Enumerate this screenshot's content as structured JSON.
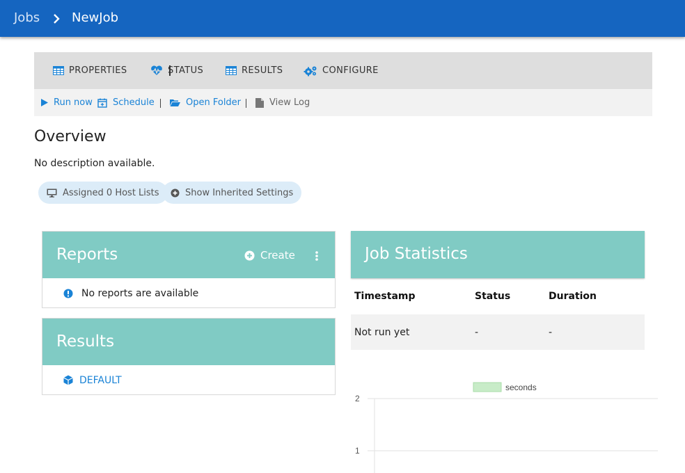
{
  "breadcrumb": {
    "root": "Jobs",
    "current": "NewJob"
  },
  "tabs": [
    {
      "label": "PROPERTIES",
      "icon": "table-icon"
    },
    {
      "label": "STATUS",
      "icon": "heartbeat-icon"
    },
    {
      "label": "RESULTS",
      "icon": "table-icon"
    },
    {
      "label": "CONFIGURE",
      "icon": "gears-icon"
    }
  ],
  "actions": {
    "run_now": "Run now",
    "schedule": "Schedule",
    "open_folder": "Open Folder",
    "view_log": "View Log"
  },
  "overview": {
    "title": "Overview",
    "description": "No description available.",
    "host_lists_chip": "Assigned 0 Host Lists",
    "inherited_chip": "Show Inherited Settings"
  },
  "reports": {
    "title": "Reports",
    "create_label": "Create",
    "empty_message": "No reports are available"
  },
  "results": {
    "title": "Results",
    "items": [
      "DEFAULT"
    ]
  },
  "job_statistics": {
    "title": "Job Statistics",
    "columns": [
      "Timestamp",
      "Status",
      "Duration"
    ],
    "rows": [
      [
        "Not run yet",
        "-",
        "-"
      ]
    ]
  },
  "colors": {
    "topbar": "#1565c0",
    "card_header": "#80cbc4",
    "link": "#1a83d6",
    "legend_fill": "#c8ecc8"
  },
  "chart_data": {
    "type": "bar",
    "series": [
      {
        "name": "seconds",
        "values": []
      }
    ],
    "y_ticks": [
      "2",
      "1"
    ],
    "legend": "top"
  }
}
